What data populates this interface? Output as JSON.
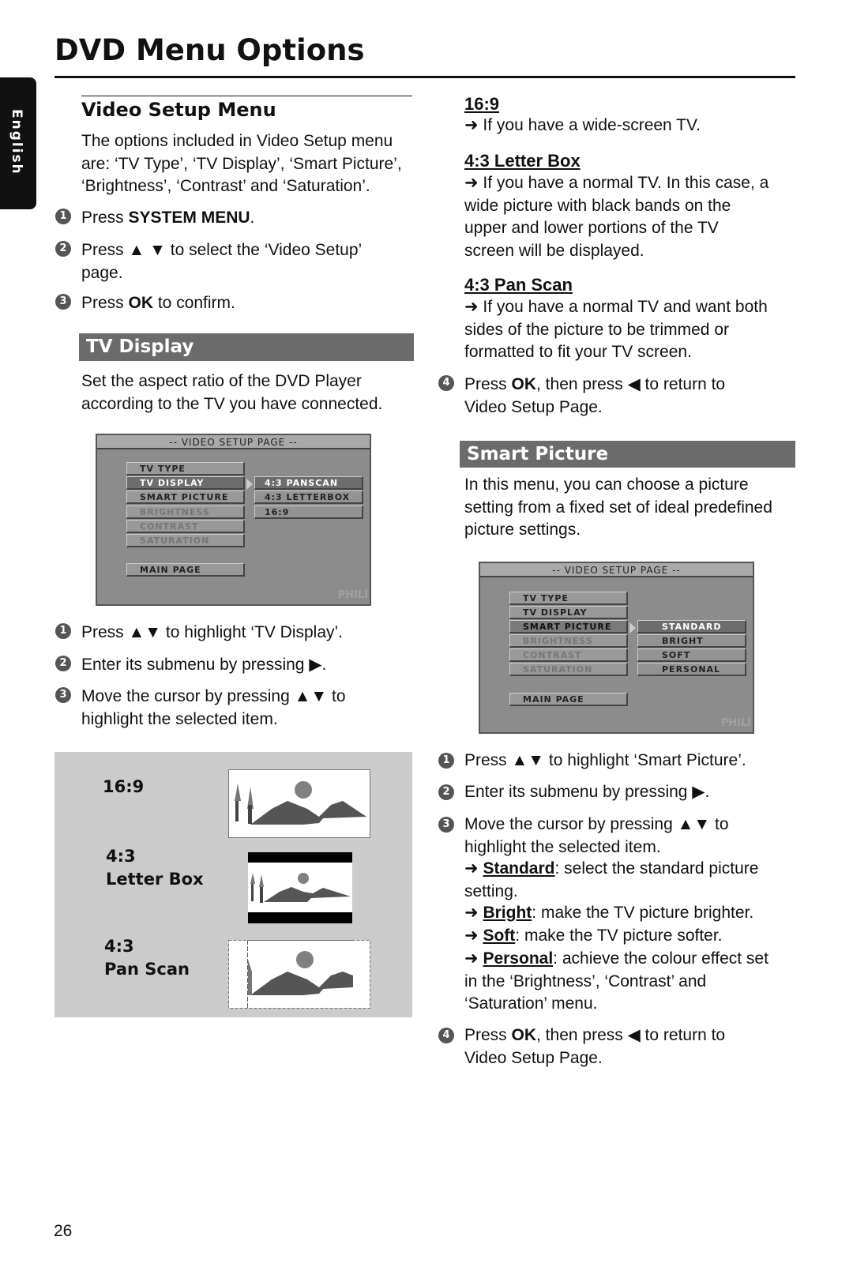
{
  "page": {
    "title": "DVD Menu Options",
    "language_tab": "English",
    "page_number": "26"
  },
  "left": {
    "heading": "Video Setup Menu",
    "intro": [
      "The options included in Video Setup menu",
      "are: ‘TV Type’, ‘TV Display’, ‘Smart Picture’,",
      "‘Brightness’, ‘Contrast’ and ‘Saturation’."
    ],
    "steps": [
      {
        "n": "1",
        "pre": "Press ",
        "bold": "SYSTEM MENU",
        "post": "."
      },
      {
        "n": "2",
        "line1": "Press ▲ ▼ to select the ‘Video Setup’",
        "line2": "page."
      },
      {
        "n": "3",
        "pre": "Press ",
        "bold": "OK",
        "post": " to confirm."
      }
    ],
    "tv_display": {
      "bar": "TV Display",
      "intro": [
        "Set the aspect ratio of the DVD Player",
        "according to the TV you have connected."
      ],
      "steps": [
        {
          "n": "1",
          "text": "Press ▲▼ to highlight ‘TV Display’."
        },
        {
          "n": "2",
          "text": "Enter its submenu by pressing ▶."
        },
        {
          "n": "3",
          "line1": "Move the cursor by pressing ▲▼ to",
          "line2": "highlight the selected item."
        }
      ]
    },
    "osd": {
      "header": "-- VIDEO SETUP PAGE --",
      "items": [
        "TV TYPE",
        "TV DISPLAY",
        "SMART PICTURE",
        "BRIGHTNESS",
        "CONTRAST",
        "SATURATION"
      ],
      "main": "MAIN PAGE",
      "submenu": [
        "4:3 PANSCAN",
        "4:3 LETTERBOX",
        "16:9"
      ],
      "watermark": "PHILI"
    },
    "illustrations": [
      {
        "label1": "16:9"
      },
      {
        "label1": "4:3",
        "label2": "Letter Box"
      },
      {
        "label1": "4:3",
        "label2": "Pan Scan"
      }
    ]
  },
  "right": {
    "options": [
      {
        "title": "16:9",
        "lines": [
          "➜ If you have a wide-screen TV."
        ]
      },
      {
        "title": "4:3 Letter Box",
        "lines": [
          "➜ If you have a normal TV. In this case, a",
          "wide picture with black bands on the",
          "upper and lower portions of the TV",
          "screen will be displayed."
        ]
      },
      {
        "title": "4:3 Pan Scan",
        "lines": [
          "➜ If you have a normal TV and want both",
          "sides of the picture to be trimmed or",
          "formatted to fit your TV screen."
        ]
      }
    ],
    "step4": {
      "n": "4",
      "pre": "Press ",
      "bold": "OK",
      "post": ", then press ◀ to return to",
      "line2": "Video Setup Page."
    },
    "smart": {
      "bar": "Smart Picture",
      "intro": [
        "In this menu, you can choose a picture",
        "setting from a fixed set of ideal predefined",
        "picture settings."
      ],
      "osd": {
        "header": "-- VIDEO SETUP PAGE --",
        "items": [
          "TV TYPE",
          "TV DISPLAY",
          "SMART PICTURE",
          "BRIGHTNESS",
          "CONTRAST",
          "SATURATION"
        ],
        "main": "MAIN PAGE",
        "submenu": [
          "STANDARD",
          "BRIGHT",
          "SOFT",
          "PERSONAL"
        ],
        "watermark": "PHILI"
      },
      "steps": [
        {
          "n": "1",
          "text": "Press ▲▼ to highlight ‘Smart Picture’."
        },
        {
          "n": "2",
          "text": "Enter its submenu by pressing ▶."
        },
        {
          "n": "3",
          "line1": "Move the cursor by pressing ▲▼ to",
          "line2": "highlight the selected item."
        }
      ],
      "choices": [
        {
          "name": "Standard",
          "desc": ": select the standard picture",
          "line2": "setting."
        },
        {
          "name": "Bright",
          "desc": ": make the TV picture brighter."
        },
        {
          "name": "Soft",
          "desc": ": make the TV picture softer."
        },
        {
          "name": "Personal",
          "desc": ": achieve the colour effect set",
          "line2": "in the ‘Brightness’, ‘Contrast’ and",
          "line3": "‘Saturation’ menu."
        }
      ],
      "arrow": "➜",
      "step4": {
        "n": "4",
        "pre": "Press ",
        "bold": "OK",
        "post": ", then press ◀ to return to",
        "line2": "Video Setup Page."
      }
    }
  }
}
